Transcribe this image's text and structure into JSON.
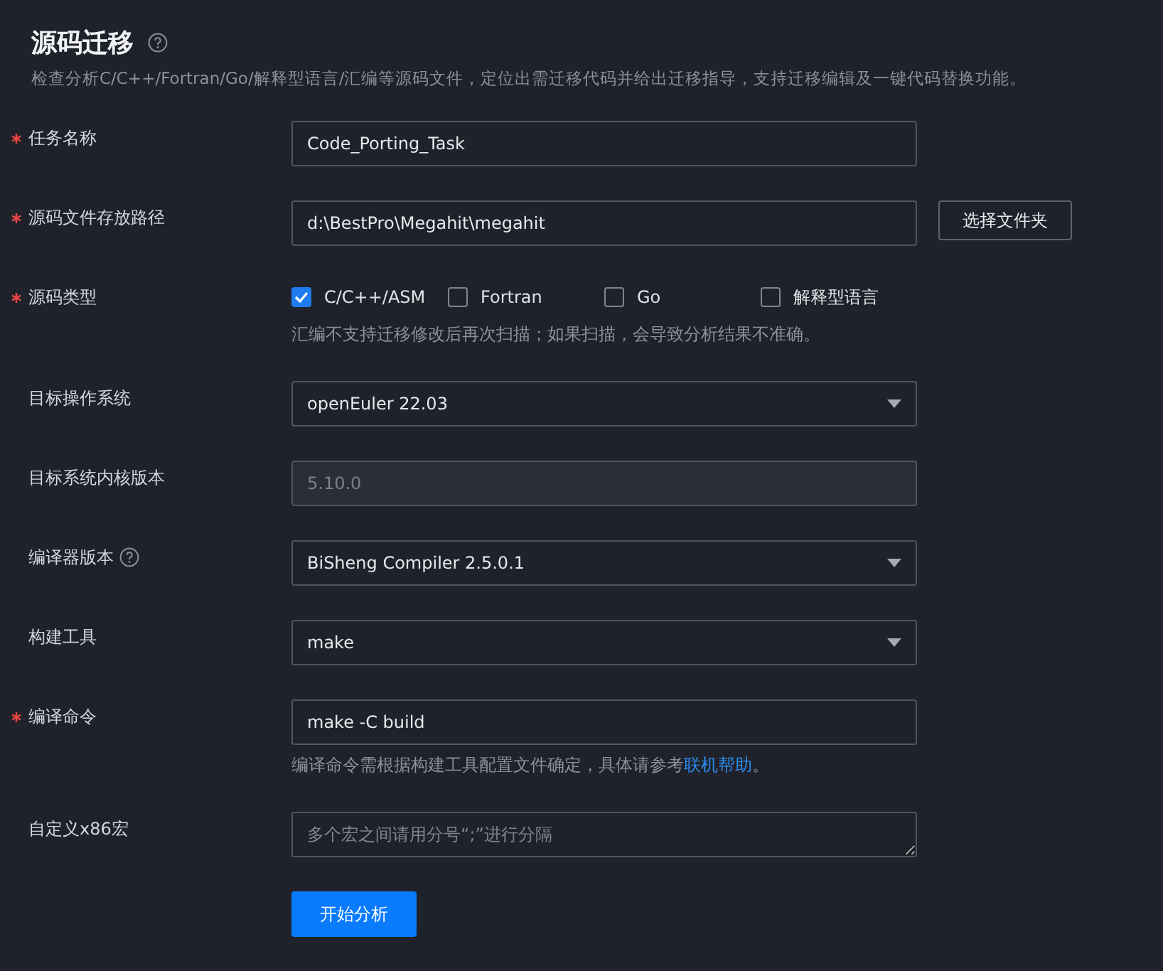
{
  "title": "源码迁移",
  "description": "检查分析C/C++/Fortran/Go/解释型语言/汇编等源码文件，定位出需迁移代码并给出迁移指导，支持迁移编辑及一键代码替换功能。",
  "fields": [
    {
      "kind": "text",
      "label": "任务名称",
      "required": true,
      "value": "Code_Porting_Task"
    },
    {
      "kind": "path",
      "label": "源码文件存放路径",
      "required": true,
      "value": "d:\\BestPro\\Megahit\\megahit",
      "button": "选择文件夹"
    },
    {
      "kind": "checkboxes",
      "label": "源码类型",
      "required": true,
      "options": [
        {
          "label": "C/C++/ASM",
          "checked": true
        },
        {
          "label": "Fortran",
          "checked": false
        },
        {
          "label": "Go",
          "checked": false
        },
        {
          "label": "解释型语言",
          "checked": false
        }
      ],
      "hint": "汇编不支持迁移修改后再次扫描；如果扫描，会导致分析结果不准确。"
    },
    {
      "kind": "select",
      "label": "目标操作系统",
      "required": false,
      "value": "openEuler 22.03"
    },
    {
      "kind": "disabled",
      "label": "目标系统内核版本",
      "required": false,
      "value": "5.10.0"
    },
    {
      "kind": "select",
      "label": "编译器版本",
      "required": false,
      "help": true,
      "value": "BiSheng Compiler 2.5.0.1"
    },
    {
      "kind": "select",
      "label": "构建工具",
      "required": false,
      "value": "make"
    },
    {
      "kind": "text",
      "label": "编译命令",
      "required": true,
      "value": "make -C build",
      "hint": "编译命令需根据构建工具配置文件确定，具体请参考",
      "link": "联机帮助",
      "hint_after": "。"
    },
    {
      "kind": "textarea",
      "label": "自定义x86宏",
      "required": false,
      "placeholder": "多个宏之间请用分号“;”进行分隔"
    }
  ],
  "submit": "开始分析"
}
